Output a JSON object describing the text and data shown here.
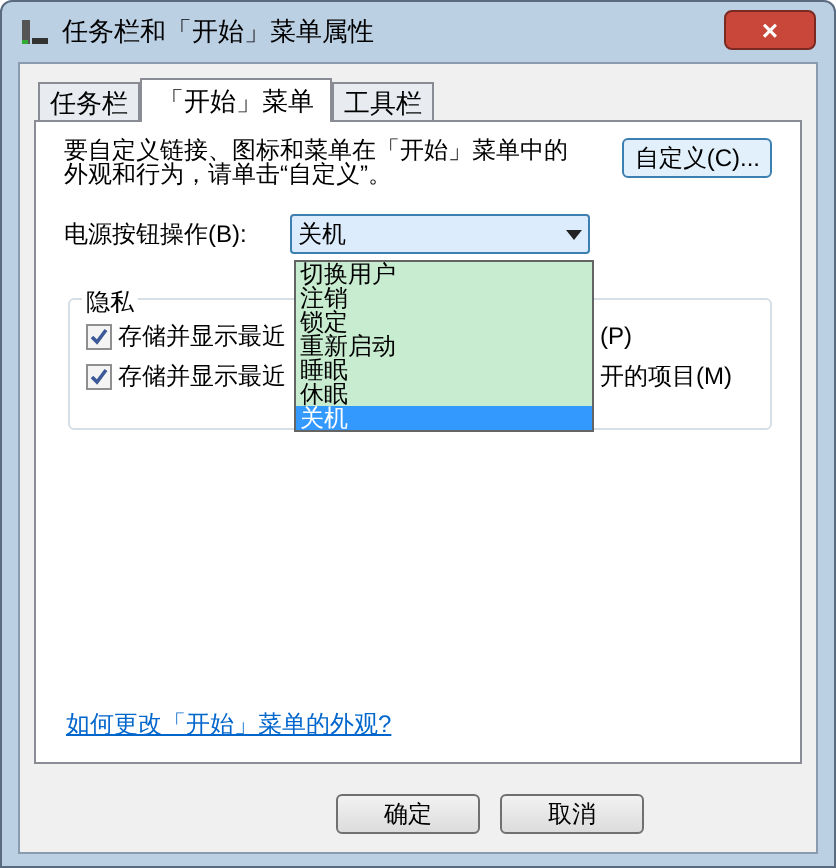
{
  "window": {
    "title": "任务栏和「开始」菜单属性",
    "close": "×"
  },
  "tabs": [
    {
      "label": "任务栏",
      "selected": false
    },
    {
      "label": "「开始」菜单",
      "selected": true
    },
    {
      "label": "工具栏",
      "selected": false
    }
  ],
  "intro": "要自定义链接、图标和菜单在「开始」菜单中的外观和行为，请单击“自定义”。",
  "customize_button": "自定义(C)...",
  "power": {
    "label": "电源按钮操作(B):",
    "value": "关机",
    "options": [
      {
        "label": "切换用户",
        "selected": false
      },
      {
        "label": "注销",
        "selected": false
      },
      {
        "label": "锁定",
        "selected": false
      },
      {
        "label": "重新启动",
        "selected": false
      },
      {
        "label": "睡眠",
        "selected": false
      },
      {
        "label": "休眠",
        "selected": false
      },
      {
        "label": "关机",
        "selected": true
      }
    ]
  },
  "privacy": {
    "title": "隐私",
    "items": [
      {
        "label_left": "存储并显示最近",
        "label_right": "(P)",
        "checked": true
      },
      {
        "label_left": "存储并显示最近",
        "label_right": "开的项目(M)",
        "checked": true
      }
    ]
  },
  "help_link": "如何更改「开始」菜单的外观?",
  "buttons": [
    "确定",
    "取消"
  ]
}
